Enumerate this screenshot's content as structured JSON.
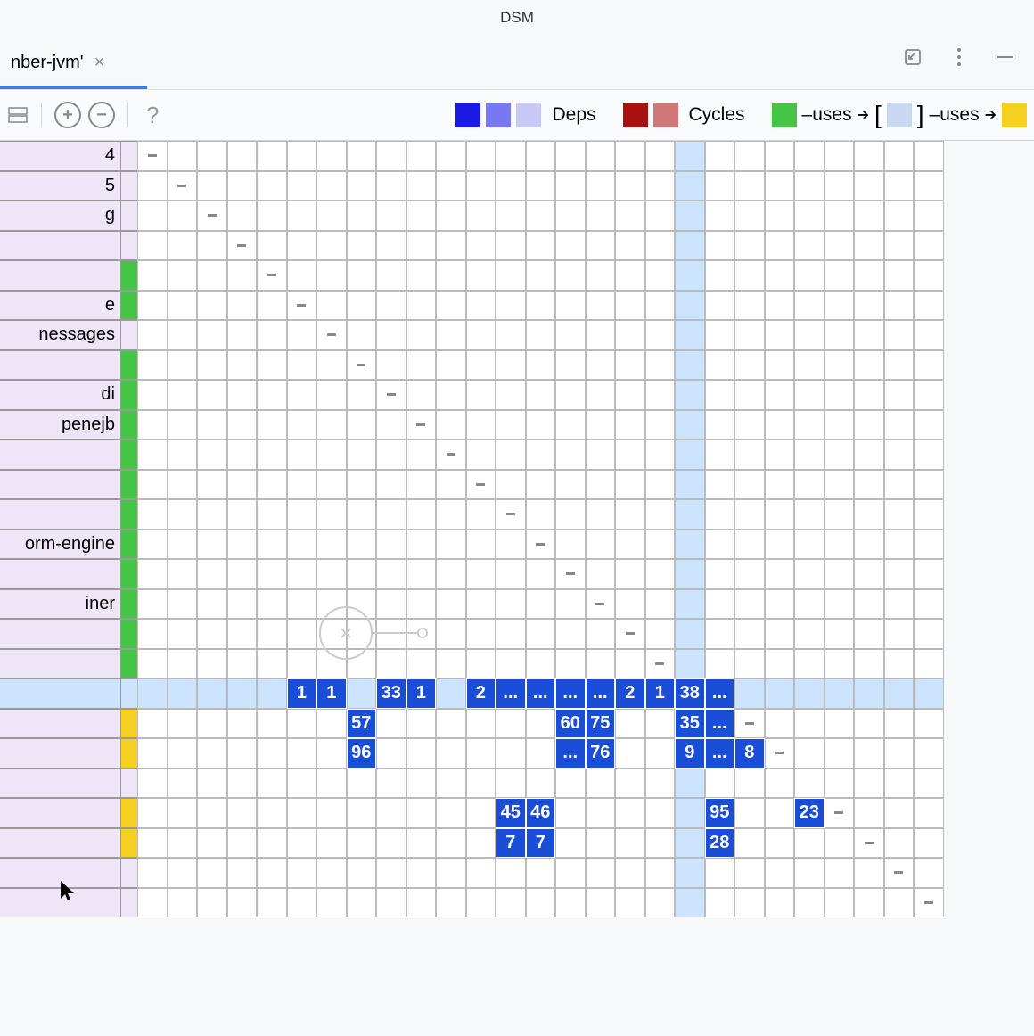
{
  "title": "DSM",
  "tab": {
    "label": "nber-jvm'",
    "close": "×"
  },
  "toolbar": {
    "collapse_icon": "",
    "expand": "+",
    "shrink": "−",
    "help": "?"
  },
  "legend": {
    "deps_label": "Deps",
    "cycles_label": "Cycles",
    "uses1": "–uses",
    "uses2": "–uses",
    "deps_colors": [
      "#1a1ae0",
      "#5858f0",
      "#b8b8f7"
    ],
    "cycles_colors": [
      "#a81010",
      "#d07878"
    ],
    "uses_green": "#45c545",
    "uses_lilac": "#c8d8f0",
    "uses_yellow": "#f5d020"
  },
  "rows": [
    {
      "label": "4",
      "stripe": "plain"
    },
    {
      "label": "5",
      "stripe": "plain"
    },
    {
      "label": "g",
      "stripe": "plain"
    },
    {
      "label": "",
      "stripe": "plain"
    },
    {
      "label": "",
      "stripe": "green"
    },
    {
      "label": "e",
      "stripe": "green"
    },
    {
      "label": "nessages",
      "stripe": "plain"
    },
    {
      "label": "",
      "stripe": "green"
    },
    {
      "label": "di",
      "stripe": "green"
    },
    {
      "label": "penejb",
      "stripe": "green"
    },
    {
      "label": "",
      "stripe": "green"
    },
    {
      "label": "",
      "stripe": "green"
    },
    {
      "label": "",
      "stripe": "green"
    },
    {
      "label": "orm-engine",
      "stripe": "green"
    },
    {
      "label": "",
      "stripe": "green"
    },
    {
      "label": "iner",
      "stripe": "green"
    },
    {
      "label": "",
      "stripe": "green"
    },
    {
      "label": "",
      "stripe": "green"
    },
    {
      "label": "",
      "stripe": "sel",
      "selected": true
    },
    {
      "label": "",
      "stripe": "yellow"
    },
    {
      "label": "",
      "stripe": "yellow"
    },
    {
      "label": "",
      "stripe": "plain"
    },
    {
      "label": "",
      "stripe": "yellow"
    },
    {
      "label": "",
      "stripe": "yellow"
    },
    {
      "label": "",
      "stripe": "plain"
    },
    {
      "label": "",
      "stripe": "plain"
    }
  ],
  "selected_row": 18,
  "selected_col": 18,
  "cells": {
    "18": {
      "5": "1",
      "6": "1",
      "8": "33",
      "9": "1",
      "11": "2",
      "12": "...",
      "13": "...",
      "14": "...",
      "15": "...",
      "16": "2",
      "17": "1",
      "18_pre": "38",
      "18": "..."
    },
    "19": {
      "7": "57",
      "14": "60",
      "15": "75",
      "18": "35",
      "19": "..."
    },
    "20": {
      "7": "96",
      "14": "...",
      "15": "76",
      "18": "9",
      "19": "...",
      "20": "8"
    },
    "22": {
      "12": "45",
      "13": "46",
      "19": "95",
      "22": "23"
    },
    "23": {
      "12": "7",
      "13": "7",
      "19": "28"
    }
  },
  "diag_offset": 0
}
